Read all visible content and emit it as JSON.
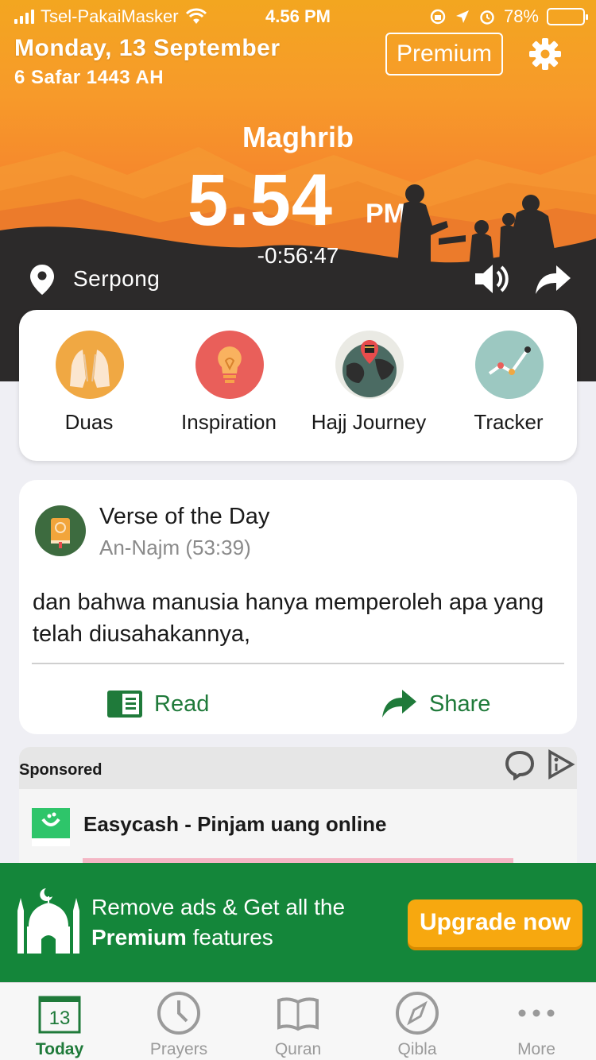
{
  "status_bar": {
    "carrier": "Tsel-PakaiMasker",
    "time": "4.56 PM",
    "battery": "78%",
    "battery_level": 0.78
  },
  "header": {
    "date": "Monday, 13 September",
    "hijri_date": "6 Safar 1443 AH",
    "premium_label": "Premium"
  },
  "prayer": {
    "name": "Maghrib",
    "time": "5.54",
    "ampm": "PM",
    "countdown": "-0:56:47",
    "location": "Serpong"
  },
  "quick_actions": [
    {
      "label": "Duas",
      "icon": "hands-praying-icon"
    },
    {
      "label": "Inspiration",
      "icon": "lightbulb-icon"
    },
    {
      "label": "Hajj Journey",
      "icon": "globe-kaaba-icon"
    },
    {
      "label": "Tracker",
      "icon": "line-chart-icon"
    }
  ],
  "verse": {
    "title": "Verse of the Day",
    "reference": "An-Najm (53:39)",
    "text": "dan bahwa manusia hanya memperoleh apa yang telah diusahakannya,",
    "read_label": "Read",
    "share_label": "Share"
  },
  "sponsored": {
    "label": "Sponsored",
    "ad_title": "Easycash - Pinjam uang online"
  },
  "upgrade": {
    "line1": "Remove ads & Get all the",
    "line2_bold": "Premium",
    "line2_rest": " features",
    "button": "Upgrade now"
  },
  "tabs": [
    {
      "label": "Today",
      "icon": "calendar-icon",
      "badge": "13"
    },
    {
      "label": "Prayers",
      "icon": "clock-icon"
    },
    {
      "label": "Quran",
      "icon": "book-icon"
    },
    {
      "label": "Qibla",
      "icon": "compass-icon"
    },
    {
      "label": "More",
      "icon": "more-dots-icon"
    }
  ],
  "colors": {
    "accent_green": "#1f7a3a",
    "banner_green": "#14863a",
    "upgrade_orange": "#f7a80f",
    "sunset_orange": "#f4802b"
  }
}
